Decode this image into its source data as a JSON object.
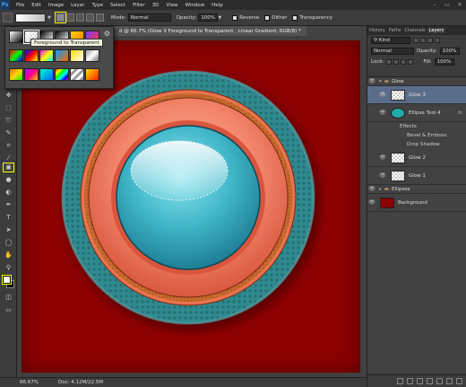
{
  "menubar": {
    "logo": "Ps",
    "items": [
      "File",
      "Edit",
      "Image",
      "Layer",
      "Type",
      "Select",
      "Filter",
      "3D",
      "View",
      "Window",
      "Help"
    ],
    "window_controls": [
      "–",
      "▭",
      "✕"
    ]
  },
  "options": {
    "mode_label": "Mode:",
    "mode_value": "Normal",
    "opacity_label": "Opacity:",
    "opacity_value": "100%",
    "reverse_label": "Reverse",
    "dither_label": "Dither",
    "transparency_label": "Transparency"
  },
  "gradient_picker": {
    "tooltip": "Foreground to Transparent",
    "gear_icon": "gear-icon"
  },
  "document": {
    "tab_title": "d @ 66.7% (Glow 3    Foreground to Transparent , Linear Gradient, RGB/8) *"
  },
  "status": {
    "zoom": "66.67%",
    "doc": "Doc: 4.12M/22.5M"
  },
  "panel": {
    "tabs": [
      "History",
      "Paths",
      "Channels",
      "Layers"
    ],
    "kind_label": "Kind",
    "blend_mode": "Normal",
    "opacity_label": "Opacity:",
    "opacity_value": "100%",
    "lock_label": "Lock:",
    "fill_label": "Fill:",
    "fill_value": "100%",
    "layers": [
      {
        "name": "Glow"
      },
      {
        "name": "Glow 3"
      },
      {
        "name": "Ellipse Tool 4",
        "fx": "fx"
      },
      {
        "name": "Effects"
      },
      {
        "name": "Bevel & Emboss"
      },
      {
        "name": "Drop Shadow"
      },
      {
        "name": "Glow 2"
      },
      {
        "name": "Glow 1"
      },
      {
        "name": "Ellipses"
      },
      {
        "name": "Background"
      }
    ]
  },
  "colors": {
    "canvas_bg": "#8b0000",
    "teal_ring": "#2e8a8f",
    "orange_ring": "#e8734f",
    "blue_center": "#3fb6c8"
  }
}
